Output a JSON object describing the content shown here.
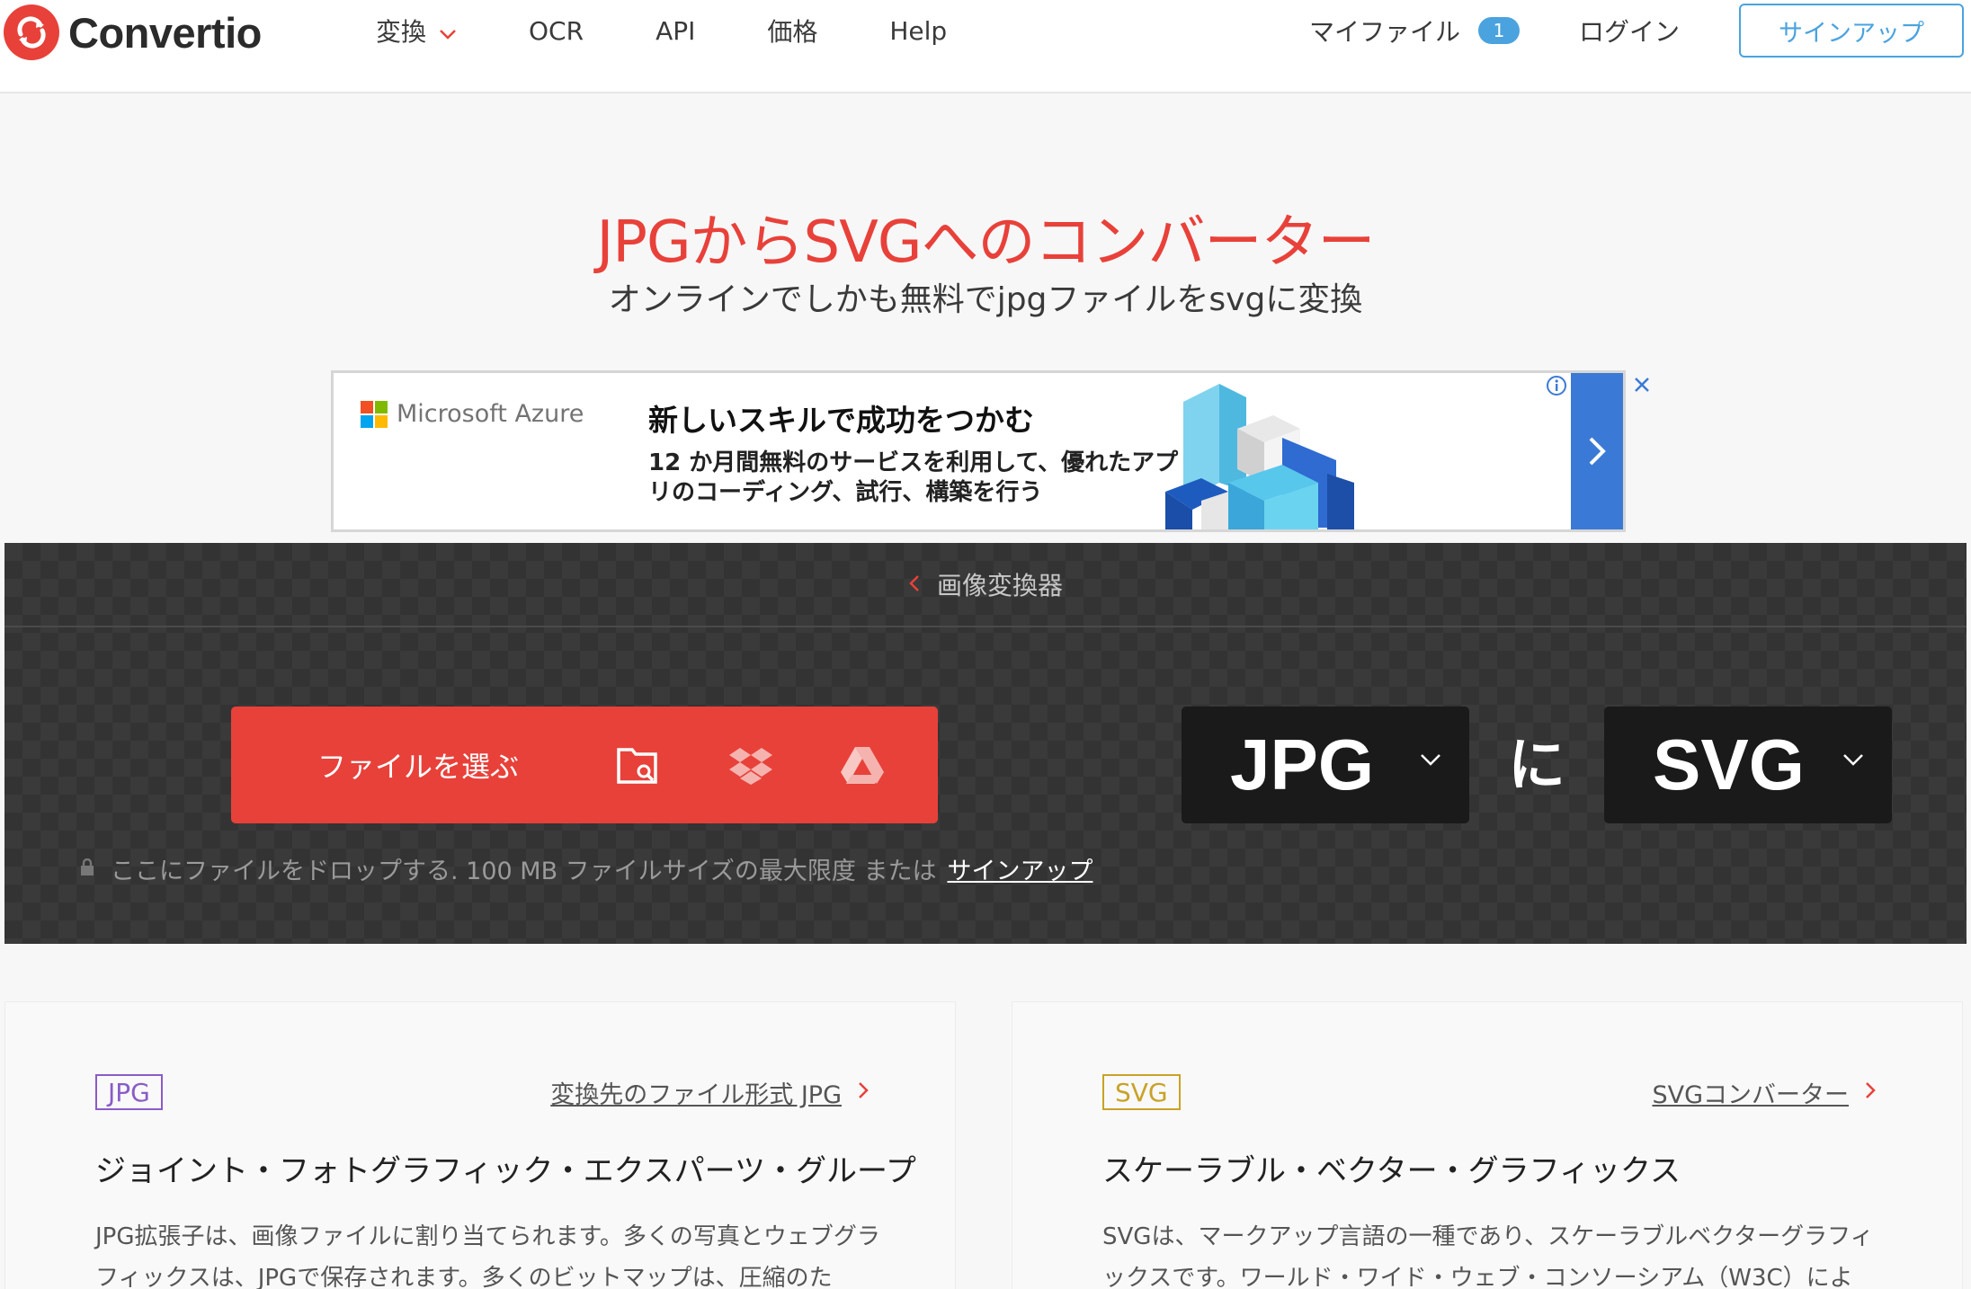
{
  "header": {
    "logo_text": "Convertio",
    "nav": [
      {
        "label": "変換",
        "has_dropdown": true
      },
      {
        "label": "OCR"
      },
      {
        "label": "API"
      },
      {
        "label": "価格"
      },
      {
        "label": "Help"
      }
    ],
    "my_files_label": "マイファイル",
    "my_files_count": "1",
    "login_label": "ログイン",
    "signup_label": "サインアップ"
  },
  "hero": {
    "title": "JPGからSVGへのコンバーター",
    "subtitle": "オンラインでしかも無料でjpgファイルをsvgに変換"
  },
  "ad": {
    "brand": "Microsoft Azure",
    "title": "新しいスキルで成功をつかむ",
    "body": "12 か月間無料のサービスを利用して、優れたアプリのコーディング、試行、構築を行う"
  },
  "converter": {
    "breadcrumb": "画像変換器",
    "choose_label": "ファイルを選ぶ",
    "from_format": "JPG",
    "connector": "に",
    "to_format": "SVG",
    "drop_note": "ここにファイルをドロップする. 100 MB ファイルサイズの最大限度 または",
    "drop_signup_link": "サインアップ"
  },
  "cards": [
    {
      "tag": "JPG",
      "tag_color": "#8a5cc7",
      "link": "変換先のファイル形式 JPG",
      "title": "ジョイント・フォトグラフィック・エクスパーツ・グループ",
      "description": "JPG拡張子は、画像ファイルに割り当てられます。多くの写真とウェブグラフィックスは、JPGで保存されます。多くのビットマップは、圧縮のた"
    },
    {
      "tag": "SVG",
      "tag_color": "#c9a227",
      "link": "SVGコンバーター",
      "title": "スケーラブル・ベクター・グラフィックス",
      "description": "SVGは、マークアップ言語の一種であり、スケーラブルベクターグラフィックスです。ワールド・ワイド・ウェブ・コンソーシアム（W3C）によ"
    }
  ],
  "colors": {
    "brand_red": "#e8413a",
    "link_blue": "#4aa3df",
    "panel_dark": "#3a3a3a",
    "format_box": "#1a1a1a"
  }
}
